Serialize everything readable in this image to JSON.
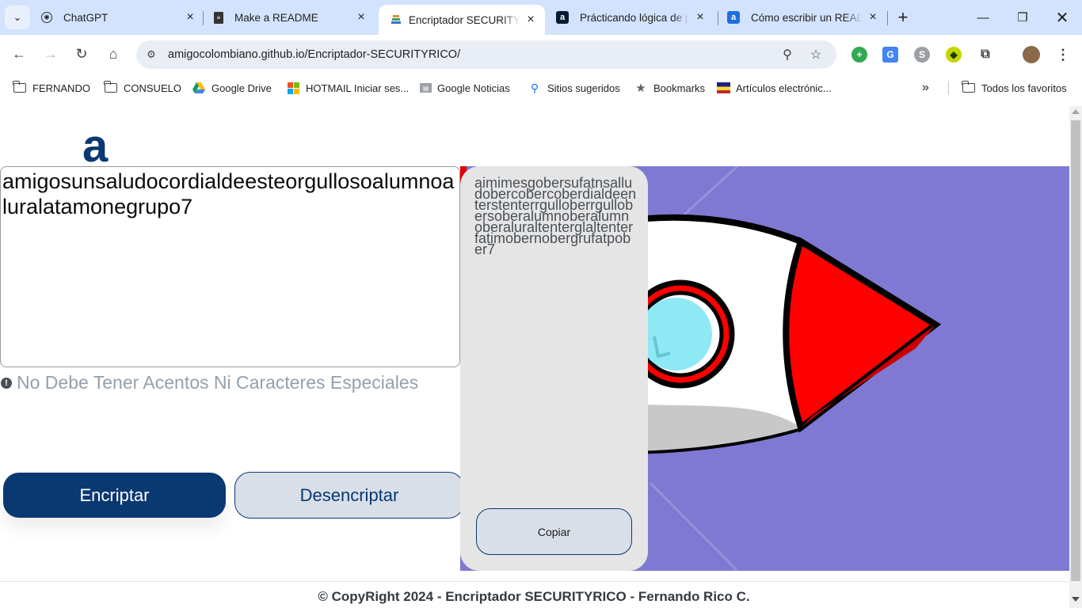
{
  "browser": {
    "tabs": [
      {
        "title": "ChatGPT",
        "icon": "chatgpt-icon"
      },
      {
        "title": "Make a README",
        "icon": "document-icon"
      },
      {
        "title": "Encriptador SECURITY-RICO",
        "icon": "layers-icon",
        "active": true
      },
      {
        "title": "Prácticando lógica de programación",
        "icon": "alura-icon"
      },
      {
        "title": "Cómo escribir un README",
        "icon": "alura-icon"
      }
    ],
    "url": "amigocolombiano.github.io/Encriptador-SECURITYRICO/",
    "bookmarks": [
      {
        "label": "FERNANDO",
        "icon": "folder-icon"
      },
      {
        "label": "CONSUELO",
        "icon": "folder-icon"
      },
      {
        "label": "Google Drive",
        "icon": "google-drive-icon"
      },
      {
        "label": "HOTMAIL Iniciar ses...",
        "icon": "microsoft-icon"
      },
      {
        "label": "Google Noticias",
        "icon": "google-news-icon"
      },
      {
        "label": "Sitios sugeridos",
        "icon": "search-icon"
      },
      {
        "label": "Bookmarks",
        "icon": "star-icon"
      },
      {
        "label": "Artículos electrónic...",
        "icon": "shop-icon"
      }
    ],
    "all_bookmarks": "Todos los favoritos",
    "overflow": "»"
  },
  "app": {
    "logo": "a",
    "input_text": "amigosunsaludocordialdeesteorgullosoalumnoaluralatamonegrupo7",
    "warning": "No Debe Tener Acentos Ni Caracteres Especiales",
    "warning_icon": "!",
    "encrypt_label": "Encriptar",
    "decrypt_label": "Desencriptar",
    "output_text": "aimimesgobersufatnsalludobercobercoberdialdeenterstenterrgulloberrgullobersoberalumnoberalumnoberaluraltenterglaltenterfatimobernobergrufatpober7",
    "copy_label": "Copiar",
    "footer": "© CopyRight 2024 - Encriptador SECURITYRICO - Fernando Rico C."
  },
  "colors": {
    "brand": "#0a3871",
    "rocket_bg": "#7f79d3",
    "card_bg": "#e5e5e5",
    "tabbar_bg": "#d3e3fd"
  }
}
